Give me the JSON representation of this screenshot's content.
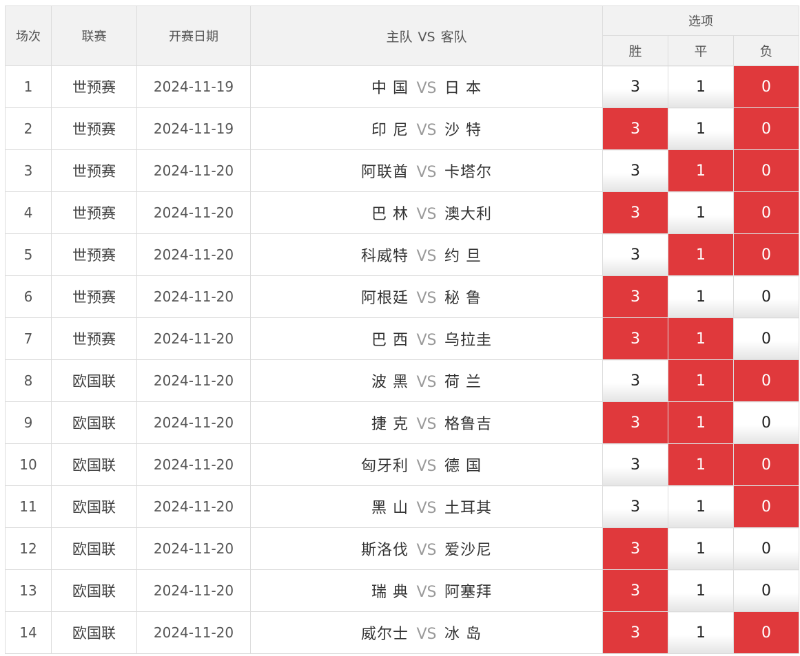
{
  "header": {
    "seq": "场次",
    "league": "联赛",
    "date": "开赛日期",
    "home": "主队",
    "vs": "VS",
    "away": "客队",
    "options": "选项",
    "win": "胜",
    "draw": "平",
    "loss": "负"
  },
  "rows": [
    {
      "seq": "1",
      "league": "世预赛",
      "date": "2024-11-19",
      "home": "中 国",
      "vs": "VS",
      "away": "日 本",
      "win": "3",
      "draw": "1",
      "loss": "0",
      "win_sel": false,
      "draw_sel": false,
      "loss_sel": true
    },
    {
      "seq": "2",
      "league": "世预赛",
      "date": "2024-11-19",
      "home": "印 尼",
      "vs": "VS",
      "away": "沙 特",
      "win": "3",
      "draw": "1",
      "loss": "0",
      "win_sel": true,
      "draw_sel": false,
      "loss_sel": true
    },
    {
      "seq": "3",
      "league": "世预赛",
      "date": "2024-11-20",
      "home": "阿联酋",
      "vs": "VS",
      "away": "卡塔尔",
      "win": "3",
      "draw": "1",
      "loss": "0",
      "win_sel": false,
      "draw_sel": true,
      "loss_sel": true
    },
    {
      "seq": "4",
      "league": "世预赛",
      "date": "2024-11-20",
      "home": "巴 林",
      "vs": "VS",
      "away": "澳大利",
      "win": "3",
      "draw": "1",
      "loss": "0",
      "win_sel": true,
      "draw_sel": false,
      "loss_sel": true
    },
    {
      "seq": "5",
      "league": "世预赛",
      "date": "2024-11-20",
      "home": "科威特",
      "vs": "VS",
      "away": "约 旦",
      "win": "3",
      "draw": "1",
      "loss": "0",
      "win_sel": false,
      "draw_sel": true,
      "loss_sel": true
    },
    {
      "seq": "6",
      "league": "世预赛",
      "date": "2024-11-20",
      "home": "阿根廷",
      "vs": "VS",
      "away": "秘 鲁",
      "win": "3",
      "draw": "1",
      "loss": "0",
      "win_sel": true,
      "draw_sel": false,
      "loss_sel": false
    },
    {
      "seq": "7",
      "league": "世预赛",
      "date": "2024-11-20",
      "home": "巴 西",
      "vs": "VS",
      "away": "乌拉圭",
      "win": "3",
      "draw": "1",
      "loss": "0",
      "win_sel": true,
      "draw_sel": true,
      "loss_sel": false
    },
    {
      "seq": "8",
      "league": "欧国联",
      "date": "2024-11-20",
      "home": "波 黑",
      "vs": "VS",
      "away": "荷 兰",
      "win": "3",
      "draw": "1",
      "loss": "0",
      "win_sel": false,
      "draw_sel": true,
      "loss_sel": true
    },
    {
      "seq": "9",
      "league": "欧国联",
      "date": "2024-11-20",
      "home": "捷 克",
      "vs": "VS",
      "away": "格鲁吉",
      "win": "3",
      "draw": "1",
      "loss": "0",
      "win_sel": true,
      "draw_sel": true,
      "loss_sel": false
    },
    {
      "seq": "10",
      "league": "欧国联",
      "date": "2024-11-20",
      "home": "匈牙利",
      "vs": "VS",
      "away": "德 国",
      "win": "3",
      "draw": "1",
      "loss": "0",
      "win_sel": false,
      "draw_sel": true,
      "loss_sel": true
    },
    {
      "seq": "11",
      "league": "欧国联",
      "date": "2024-11-20",
      "home": "黑 山",
      "vs": "VS",
      "away": "土耳其",
      "win": "3",
      "draw": "1",
      "loss": "0",
      "win_sel": false,
      "draw_sel": false,
      "loss_sel": true
    },
    {
      "seq": "12",
      "league": "欧国联",
      "date": "2024-11-20",
      "home": "斯洛伐",
      "vs": "VS",
      "away": "爱沙尼",
      "win": "3",
      "draw": "1",
      "loss": "0",
      "win_sel": true,
      "draw_sel": false,
      "loss_sel": false
    },
    {
      "seq": "13",
      "league": "欧国联",
      "date": "2024-11-20",
      "home": "瑞 典",
      "vs": "VS",
      "away": "阿塞拜",
      "win": "3",
      "draw": "1",
      "loss": "0",
      "win_sel": true,
      "draw_sel": false,
      "loss_sel": false
    },
    {
      "seq": "14",
      "league": "欧国联",
      "date": "2024-11-20",
      "home": "威尔士",
      "vs": "VS",
      "away": "冰 岛",
      "win": "3",
      "draw": "1",
      "loss": "0",
      "win_sel": true,
      "draw_sel": false,
      "loss_sel": true
    }
  ],
  "colors": {
    "selected_bg": "#e0393c",
    "header_bg": "#f2f2f2",
    "border": "#dcdcdc"
  }
}
